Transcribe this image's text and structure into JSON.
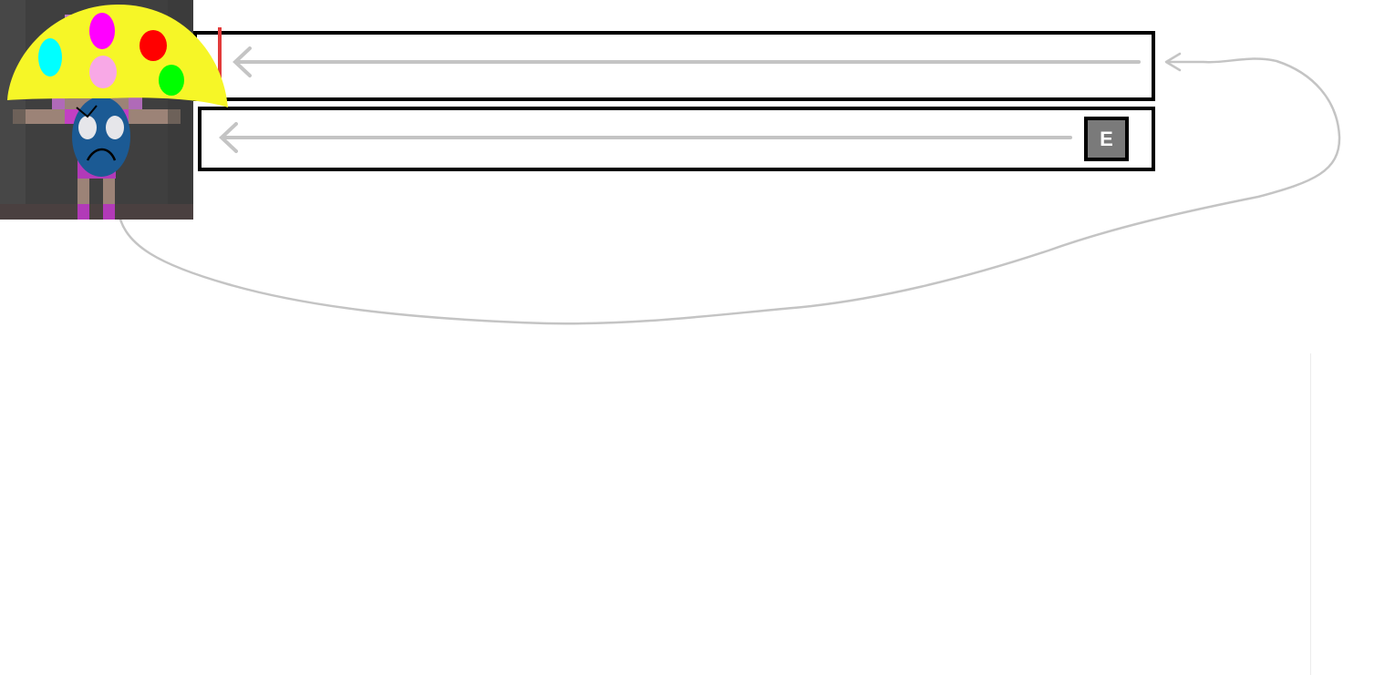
{
  "track": {
    "key_badge": {
      "label": "E"
    }
  },
  "colors": {
    "lane_border": "#000000",
    "flow_arrow": "#c4c4c4",
    "playhead": "#e23b3b",
    "key_badge_bg": "#7a7a7a",
    "player_hair": "#b56fc0",
    "player_outfit": "#b23ab8",
    "player_eyes": "#cc00cc",
    "mushroom_cap": "#f6f627",
    "mushroom_stem": "#1b5a94"
  },
  "icons": {
    "playhead": "red-vertical-line",
    "lane_arrows": "left-arrow",
    "loop": "loop-curve-arrow",
    "player": "pixel-girl-sprite",
    "enemy": "angry-mushroom-sprite"
  }
}
